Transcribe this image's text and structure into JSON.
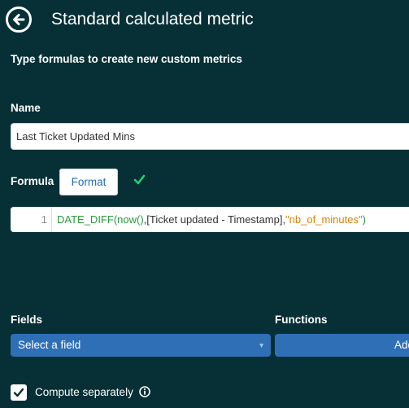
{
  "header": {
    "title": "Standard calculated metric",
    "back_icon": "arrow-left-circle-icon"
  },
  "intro": "Type formulas to create new custom metrics",
  "name": {
    "label": "Name",
    "value": "Last Ticket Updated Mins"
  },
  "formula": {
    "label": "Formula",
    "format_label": "Format",
    "valid_icon": "check-icon",
    "line_number": "1",
    "code": {
      "fn1": "DATE_DIFF(",
      "fn2": "now()",
      "sep1": ",",
      "field": "[Ticket updated - Timestamp]",
      "sep2": ",",
      "unit": "\"nb_of_minutes\"",
      "close": ")"
    }
  },
  "fields": {
    "label": "Fields",
    "select_label": "Select a field"
  },
  "functions": {
    "label": "Functions",
    "add_label": "Add"
  },
  "compute": {
    "label": "Compute separately",
    "checked": true,
    "info_icon": "info-circle-icon"
  },
  "colors": {
    "background": "#063036",
    "accent": "#2f6fb6",
    "success": "#2ecc71",
    "code_function": "#2a9b3e",
    "code_string": "#d98200"
  }
}
